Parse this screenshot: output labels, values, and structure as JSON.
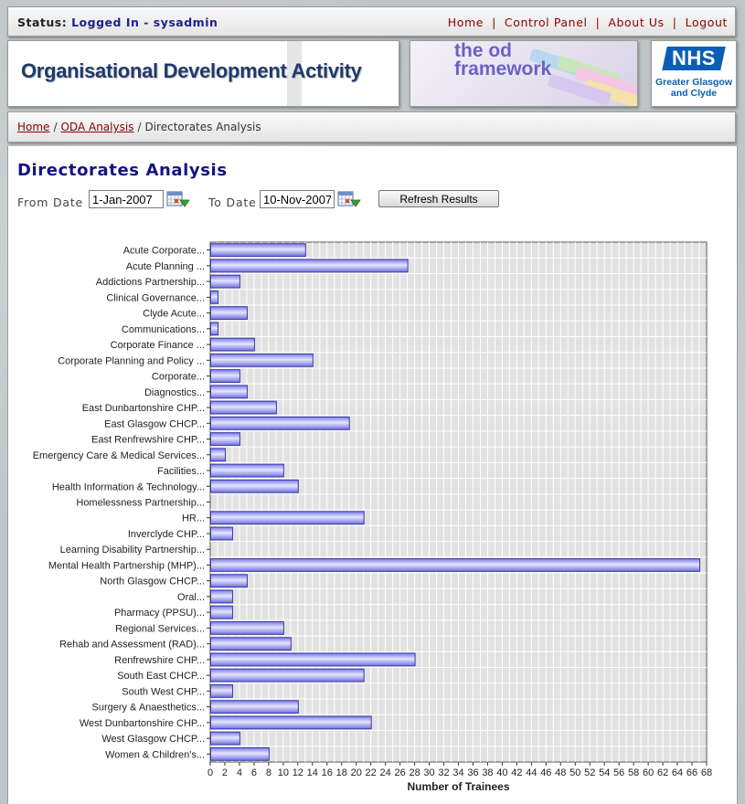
{
  "header": {
    "status_label": "Status:",
    "status_value": "Logged In - sysadmin",
    "nav": [
      "Home",
      "Control Panel",
      "About Us",
      "Logout"
    ]
  },
  "banner": {
    "title": "Organisational Development Activity",
    "od_logo_line1": "the od",
    "od_logo_line2": "framework",
    "nhs_mark": "NHS",
    "nhs_sub1": "Greater Glasgow",
    "nhs_sub2": "and Clyde"
  },
  "breadcrumb": {
    "home": "Home",
    "oda": "ODA Analysis",
    "current": "Directorates Analysis",
    "sep": "/"
  },
  "page": {
    "title": "Directorates Analysis",
    "from_label": "From Date",
    "from_value": "1-Jan-2007",
    "to_label": "To Date",
    "to_value": "10-Nov-2007",
    "refresh_label": "Refresh Results"
  },
  "colors": {
    "bar_fill": "#9c9cf4",
    "bar_stroke": "#3a3aa8",
    "plot_bg": "#e2e2e2",
    "grid": "#ffffff",
    "title_blue": "#141480",
    "link_red": "#8b0000"
  },
  "chart_data": {
    "type": "bar",
    "orientation": "horizontal",
    "xlabel": "Number of Trainees",
    "ylabel": "",
    "xlim": [
      0,
      68
    ],
    "x_ticks": [
      0,
      2,
      4,
      6,
      8,
      10,
      12,
      14,
      16,
      18,
      20,
      22,
      24,
      26,
      28,
      30,
      32,
      34,
      36,
      38,
      40,
      42,
      44,
      46,
      48,
      50,
      52,
      54,
      56,
      58,
      60,
      62,
      64,
      66,
      68
    ],
    "grid": true,
    "categories": [
      "Acute Corporate...",
      "Acute Planning ...",
      "Addictions Partnership...",
      "Clinical Governance...",
      "Clyde Acute...",
      "Communications...",
      "Corporate Finance ...",
      "Corporate Planning and Policy ...",
      "Corporate...",
      "Diagnostics...",
      "East Dunbartonshire CHP...",
      "East Glasgow CHCP...",
      "East Renfrewshire CHP...",
      "Emergency Care & Medical Services...",
      "Facilities...",
      "Health Information & Technology...",
      "Homelessness Partnership...",
      "HR...",
      "Inverclyde CHP...",
      "Learning Disability Partnership...",
      "Mental Health Partnership (MHP)...",
      "North Glasgow CHCP...",
      "Oral...",
      "Pharmacy (PPSU)...",
      "Regional Services...",
      "Rehab and Assessment (RAD)...",
      "Renfrewshire CHP...",
      "South East CHCP...",
      "South West CHP...",
      "Surgery & Anaesthetics...",
      "West Dunbartonshire CHP...",
      "West Glasgow CHCP...",
      "Women & Children's..."
    ],
    "values": [
      13,
      27,
      4,
      1,
      5,
      1,
      6,
      14,
      4,
      5,
      9,
      19,
      4,
      2,
      10,
      12,
      0,
      21,
      3,
      0,
      67,
      5,
      3,
      3,
      10,
      11,
      28,
      21,
      3,
      12,
      22,
      4,
      8
    ]
  }
}
